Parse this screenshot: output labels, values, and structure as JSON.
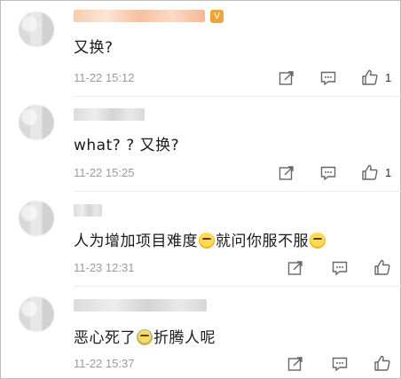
{
  "comments": [
    {
      "text_before": "又换?",
      "emoji": "",
      "text_after": "",
      "time": "11-22 15:12",
      "likes": "1"
    },
    {
      "text_before": "what? ? 又换?",
      "emoji": "",
      "text_after": "",
      "time": "11-22 15:25",
      "likes": "1"
    },
    {
      "text_before": "人为增加项目难度",
      "emoji": "emoji-laugh",
      "text_after": "就问你服不服",
      "emoji2": "emoji-sunglasses",
      "time": "11-23 12:31",
      "likes": ""
    },
    {
      "text_before": "恶心死了",
      "emoji": "emoji-tears-of-joy",
      "text_after": "折腾人呢",
      "time": "11-22 15:37",
      "likes": ""
    }
  ],
  "icons": {
    "share": "share-icon",
    "comment": "comment-icon",
    "like": "thumbs-up-icon"
  },
  "colors": {
    "time": "#9b9b9b",
    "text": "#1a1a1a",
    "badge": "#f0a33a"
  }
}
